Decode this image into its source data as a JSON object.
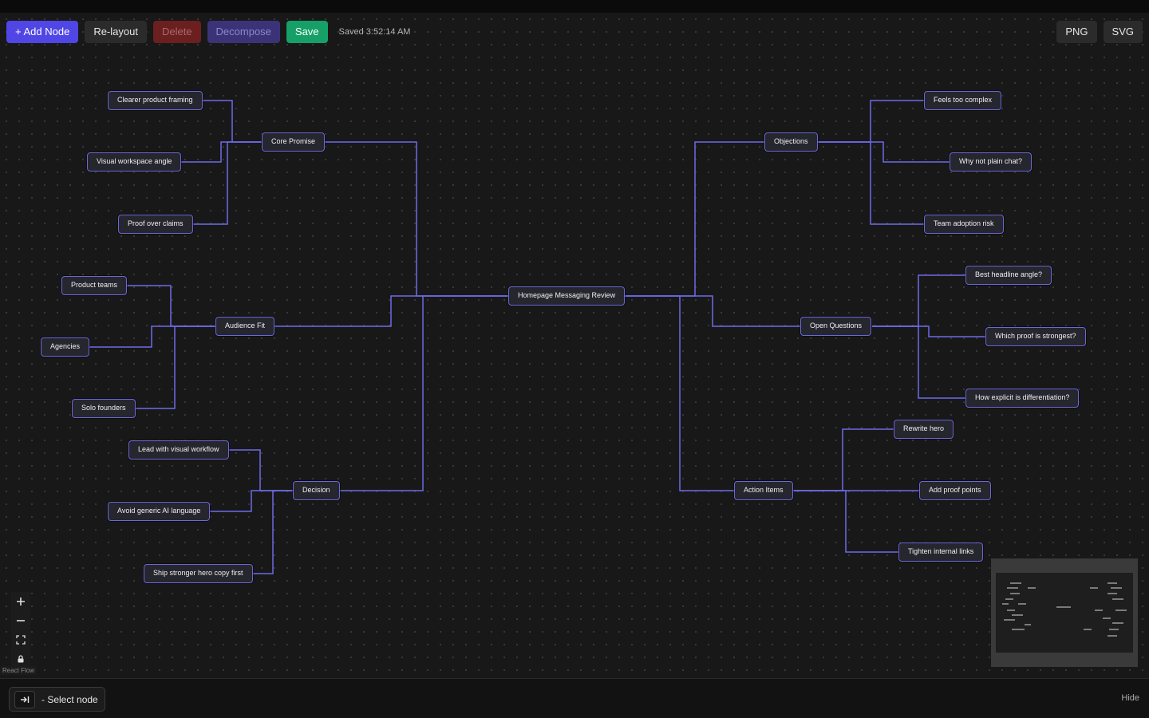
{
  "toolbar": {
    "add_node": "+ Add Node",
    "relayout": "Re-layout",
    "delete": "Delete",
    "decompose": "Decompose",
    "save": "Save",
    "saved_status": "Saved 3:52:14 AM"
  },
  "export": {
    "png": "PNG",
    "svg": "SVG"
  },
  "mindmap": {
    "root": "Homepage Messaging Review",
    "branches": {
      "core_promise": {
        "label": "Core Promise",
        "children": [
          "Clearer product framing",
          "Visual workspace angle",
          "Proof over claims"
        ]
      },
      "audience_fit": {
        "label": "Audience Fit",
        "children": [
          "Product teams",
          "Agencies",
          "Solo founders"
        ]
      },
      "decision": {
        "label": "Decision",
        "children": [
          "Lead with visual workflow",
          "Avoid generic AI language",
          "Ship stronger hero copy first"
        ]
      },
      "objections": {
        "label": "Objections",
        "children": [
          "Feels too complex",
          "Why not plain chat?",
          "Team adoption risk"
        ]
      },
      "open_questions": {
        "label": "Open Questions",
        "children": [
          "Best headline angle?",
          "Which proof is strongest?",
          "How explicit is differentiation?"
        ]
      },
      "action_items": {
        "label": "Action Items",
        "children": [
          "Rewrite hero",
          "Add proof points",
          "Tighten internal links"
        ]
      }
    }
  },
  "colors": {
    "accent": "#4f46e5",
    "edge": "#6d6ae8",
    "save": "#16a067"
  },
  "controls": {
    "zoom_in": "plus-icon",
    "zoom_out": "minus-icon",
    "fit_view": "fit-view-icon",
    "lock": "lock-icon"
  },
  "attribution": "React Flow",
  "footer": {
    "select_node": "- Select node",
    "select_icon": "arrow-to-bar-icon",
    "hide": "Hide"
  }
}
